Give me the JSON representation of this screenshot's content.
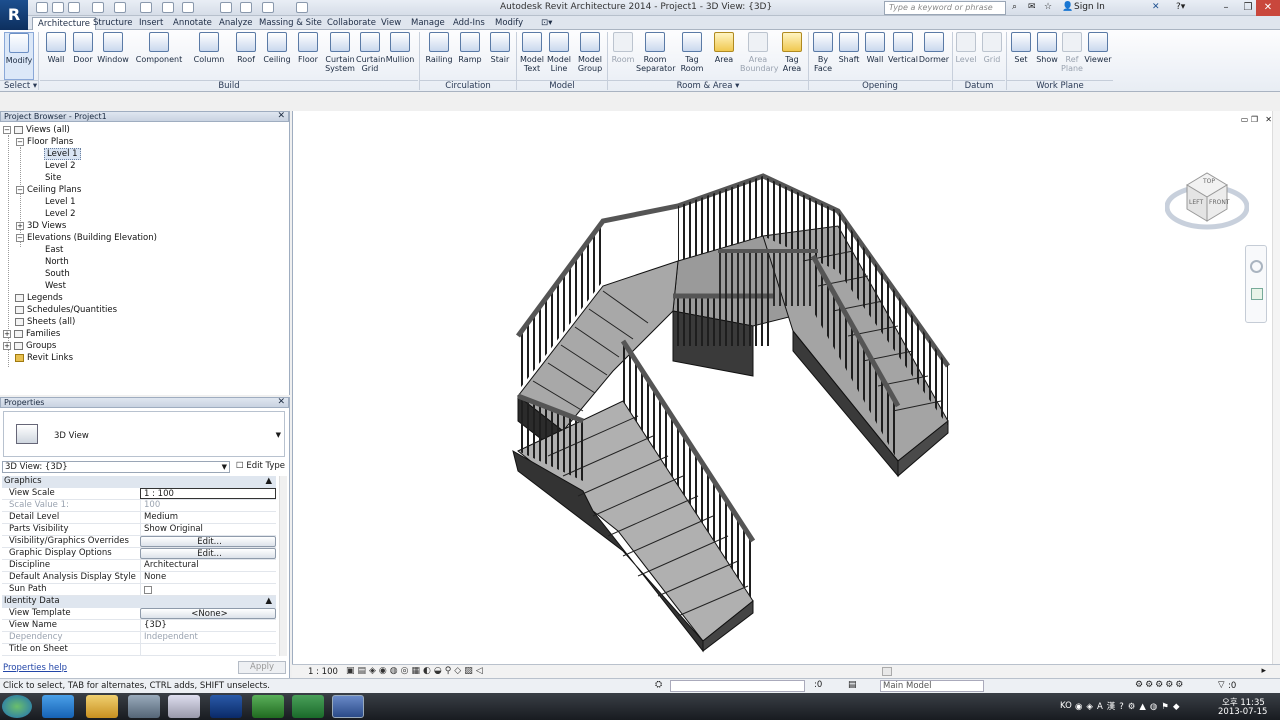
{
  "window": {
    "title": "Autodesk Revit Architecture 2014 -     Project1 - 3D View: {3D}"
  },
  "titlebar": {
    "search_placeholder": "Type a keyword or phrase",
    "sign_in": "Sign In"
  },
  "ribbon_tabs": [
    "Architecture",
    "Structure",
    "Insert",
    "Annotate",
    "Analyze",
    "Massing & Site",
    "Collaborate",
    "View",
    "Manage",
    "Add-Ins",
    "Modify"
  ],
  "ribbon": {
    "buttons": [
      {
        "label": "Modify"
      },
      {
        "label": "Wall"
      },
      {
        "label": "Door"
      },
      {
        "label": "Window"
      },
      {
        "label": "Component"
      },
      {
        "label": "Column"
      },
      {
        "label": "Roof"
      },
      {
        "label": "Ceiling"
      },
      {
        "label": "Floor"
      },
      {
        "label": "Curtain\nSystem"
      },
      {
        "label": "Curtain\nGrid"
      },
      {
        "label": "Mullion"
      },
      {
        "label": "Railing"
      },
      {
        "label": "Ramp"
      },
      {
        "label": "Stair"
      },
      {
        "label": "Model\nText"
      },
      {
        "label": "Model\nLine"
      },
      {
        "label": "Model\nGroup"
      },
      {
        "label": "Room"
      },
      {
        "label": "Room\nSeparator"
      },
      {
        "label": "Tag\nRoom"
      },
      {
        "label": "Area"
      },
      {
        "label": "Area\nBoundary"
      },
      {
        "label": "Tag\nArea"
      },
      {
        "label": "By\nFace"
      },
      {
        "label": "Shaft"
      },
      {
        "label": "Wall"
      },
      {
        "label": "Vertical"
      },
      {
        "label": "Dormer"
      },
      {
        "label": "Level"
      },
      {
        "label": "Grid"
      },
      {
        "label": "Set"
      },
      {
        "label": "Show"
      },
      {
        "label": "Ref\nPlane"
      },
      {
        "label": "Viewer"
      }
    ],
    "groups": [
      "Select ▾",
      "Build",
      "Circulation",
      "Model",
      "Room & Area ▾",
      "Opening",
      "Datum",
      "Work Plane"
    ]
  },
  "project_browser": {
    "title": "Project Browser - Project1",
    "items": [
      {
        "label": "Views (all)"
      },
      {
        "label": "Floor Plans"
      },
      {
        "label": "Level 1"
      },
      {
        "label": "Level 2"
      },
      {
        "label": "Site"
      },
      {
        "label": "Ceiling Plans"
      },
      {
        "label": "Level 1"
      },
      {
        "label": "Level 2"
      },
      {
        "label": "3D Views"
      },
      {
        "label": "Elevations (Building Elevation)"
      },
      {
        "label": "East"
      },
      {
        "label": "North"
      },
      {
        "label": "South"
      },
      {
        "label": "West"
      },
      {
        "label": "Legends"
      },
      {
        "label": "Schedules/Quantities"
      },
      {
        "label": "Sheets (all)"
      },
      {
        "label": "Families"
      },
      {
        "label": "Groups"
      },
      {
        "label": "Revit Links"
      }
    ]
  },
  "properties": {
    "title": "Properties",
    "type_name": "3D View",
    "instance": "3D View: {3D}",
    "edit_type": "Edit Type",
    "rows": [
      {
        "name": "Graphics",
        "value": "▲"
      },
      {
        "name": "View Scale",
        "value": "1 : 100"
      },
      {
        "name": "Scale Value    1:",
        "value": "100"
      },
      {
        "name": "Detail Level",
        "value": "Medium"
      },
      {
        "name": "Parts Visibility",
        "value": "Show Original"
      },
      {
        "name": "Visibility/Graphics Overrides",
        "value": "Edit..."
      },
      {
        "name": "Graphic Display Options",
        "value": "Edit..."
      },
      {
        "name": "Discipline",
        "value": "Architectural"
      },
      {
        "name": "Default Analysis Display Style",
        "value": "None"
      },
      {
        "name": "Sun Path",
        "value": ""
      },
      {
        "name": "Identity Data",
        "value": "▲"
      },
      {
        "name": "View Template",
        "value": "<None>"
      },
      {
        "name": "View Name",
        "value": "{3D}"
      },
      {
        "name": "Dependency",
        "value": "Independent"
      },
      {
        "name": "Title on Sheet",
        "value": ""
      }
    ],
    "help": "Properties help",
    "apply": "Apply"
  },
  "viewcube": {
    "top": "TOP",
    "left": "LEFT",
    "front": "FRONT"
  },
  "view_controls": {
    "scale": "1 : 100"
  },
  "status": {
    "message": "Click to select, TAB for alternates, CTRL adds, SHIFT unselects.",
    "count": ":0",
    "model": "Main Model",
    "filter": ":0"
  },
  "taskbar": {
    "lang": "KO",
    "time": "오후 11:35",
    "date": "2013-07-15"
  },
  "colors": {
    "accent": "#1c4f8f",
    "ribbon_bg": "#e8edf4",
    "selection": "#d9e4f3"
  }
}
